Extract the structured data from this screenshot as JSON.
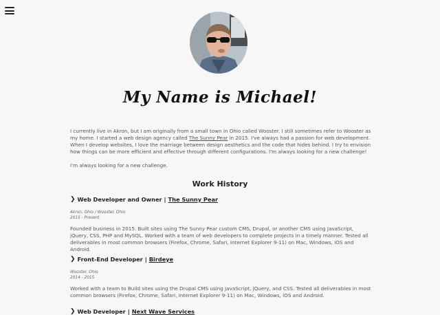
{
  "nav": {
    "menu_icon": "hamburger-icon"
  },
  "profile": {
    "title": "My Name is Michael!",
    "intro_p1": "I currently live in Akron, but I am originally from a small town in Ohio called Wooster. I still sometimes refer to Wooster as my home. I started a web design agency called ",
    "intro_link": "The Sunny Pear",
    "intro_p2": " in 2015. I've always had a passion for web development. When I develop websites, I love the marriage between design aesthetics and the code that hides behind. I try to envision how things can be more efficient and effective through different configurations. I'm always looking for a new challenge!",
    "challenge": "I'm always looking for a new challenge."
  },
  "work": {
    "heading": "Work History",
    "jobs": [
      {
        "role": "Web Developer and Owner",
        "sep": "|",
        "company": "The Sunny Pear",
        "location": "Akron, Ohio / Wooster, Ohio",
        "dates": "2015 - Present",
        "description": "Founded business in 2015. Built sites using The Sunny Pear custom CMS, Drupal, or another CMS using JavaScript, jQuery, CSS, PHP and MySQL. Worked with a team of web developers to complete projects in a timely manner. Tested all deliverables in most common browsers (Firefox, Chrome, Safari, Internet Explorer 9-11) on Mac, Windows, iOS and Android."
      },
      {
        "role": "Front-End Developer",
        "sep": "|",
        "company": "Birdeye",
        "location": "Wooster, Ohio",
        "dates": "2014 - 2015",
        "description": "Worked with a team to Build sites using the Drupal CMS using JavaScript, jQuery, and CSS. Tested all deliverables in most common browsers (Firefox, Chrome, Safari, Internet Explorer 9-11) on Mac, Windows, iOS and Android."
      },
      {
        "role": "Web Developer",
        "sep": "|",
        "company": "Next Wave Services"
      }
    ]
  }
}
